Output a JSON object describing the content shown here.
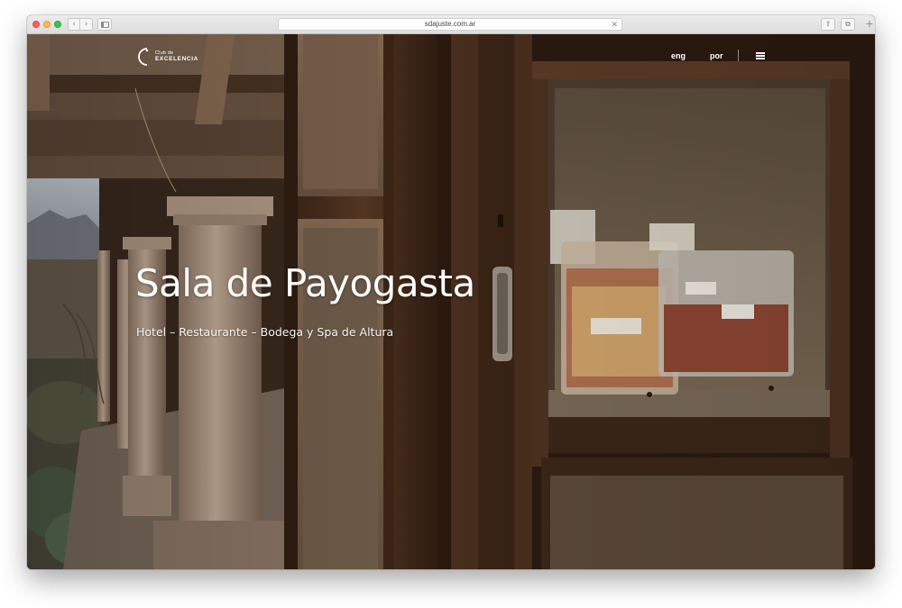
{
  "browser": {
    "url": "sdajuste.com.ar",
    "clear_icon": "✕",
    "back_icon": "‹",
    "forward_icon": "›",
    "share_icon": "⇪",
    "tabs_icon": "⧉",
    "new_tab_icon": "+"
  },
  "header": {
    "logo_line1": "Club de",
    "logo_line2": "EXCELENCIA",
    "lang_eng": "eng",
    "lang_por": "por",
    "menu_icon": "hamburger-menu-icon"
  },
  "hero": {
    "title": "Sala de Payogasta",
    "subtitle": "Hotel – Restaurante – Bodega y Spa de Altura"
  }
}
